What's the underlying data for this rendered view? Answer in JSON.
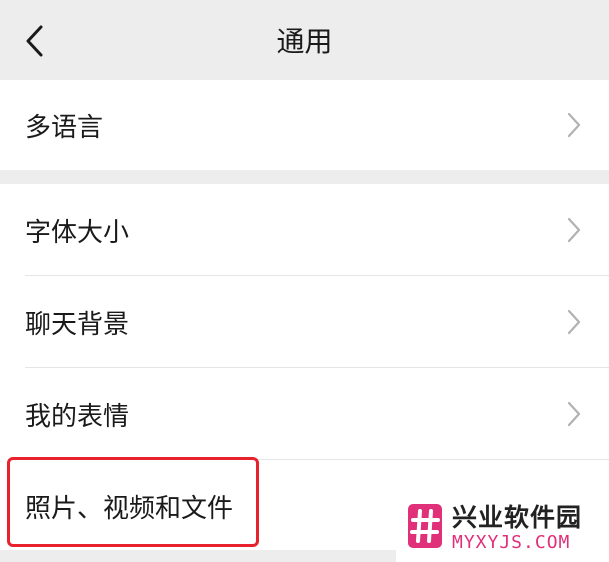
{
  "header": {
    "title": "通用",
    "back_icon": "chevron-left-icon"
  },
  "settings_groups": [
    {
      "items": [
        {
          "label": "多语言",
          "icon": "chevron-right-icon"
        }
      ]
    },
    {
      "items": [
        {
          "label": "字体大小",
          "icon": "chevron-right-icon"
        },
        {
          "label": "聊天背景",
          "icon": "chevron-right-icon"
        },
        {
          "label": "我的表情",
          "icon": "chevron-right-icon"
        },
        {
          "label": "照片、视频和文件",
          "highlighted": true
        }
      ]
    }
  ],
  "annotation": {
    "highlight_color": "#e8222c"
  },
  "watermark": {
    "title": "兴业软件园",
    "domain": "MYXYJS.COM",
    "brand_color": "#e0307a"
  }
}
